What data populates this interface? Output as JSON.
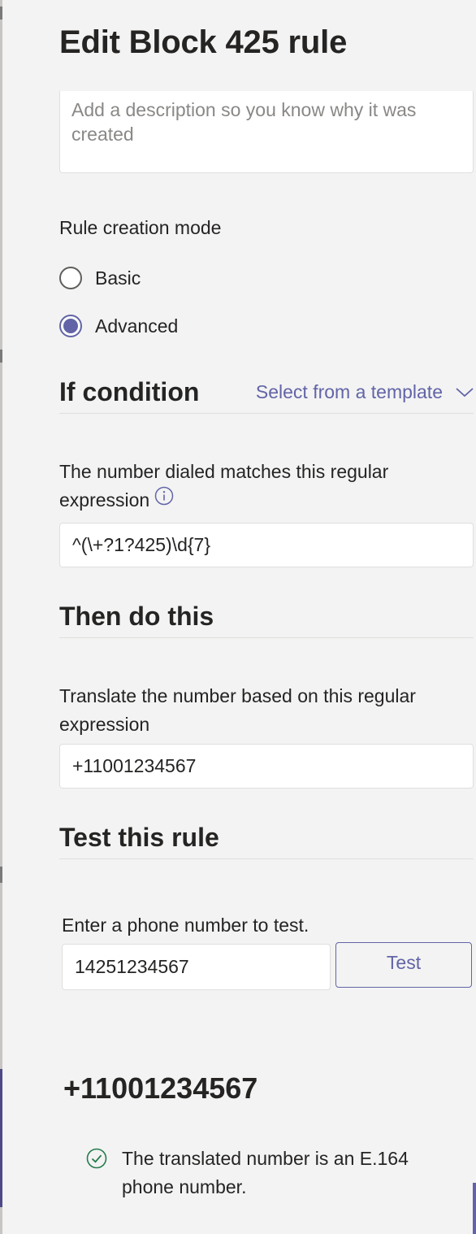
{
  "panel": {
    "title": "Edit Block 425 rule"
  },
  "description": {
    "placeholder": "Add a description so you know why it was created",
    "value": ""
  },
  "mode": {
    "label": "Rule creation mode",
    "options": [
      {
        "label": "Basic",
        "selected": false
      },
      {
        "label": "Advanced",
        "selected": true
      }
    ]
  },
  "if_condition": {
    "title": "If condition",
    "template_label": "Select from a template",
    "field_label": "The number dialed matches this regular expression",
    "value": "^(\\+?1?425)\\d{7}"
  },
  "then": {
    "title": "Then do this",
    "field_label": "Translate the number based on this regular expression",
    "value": "+11001234567"
  },
  "test": {
    "title": "Test this rule",
    "field_label": "Enter a phone number to test.",
    "value": "14251234567",
    "button_label": "Test"
  },
  "result": {
    "number": "+11001234567",
    "status_text": "The translated number is an E.164 phone number.",
    "status_color": "#237b4b"
  },
  "colors": {
    "accent": "#6264a7",
    "background": "#f3f3f3",
    "text": "#252423"
  }
}
